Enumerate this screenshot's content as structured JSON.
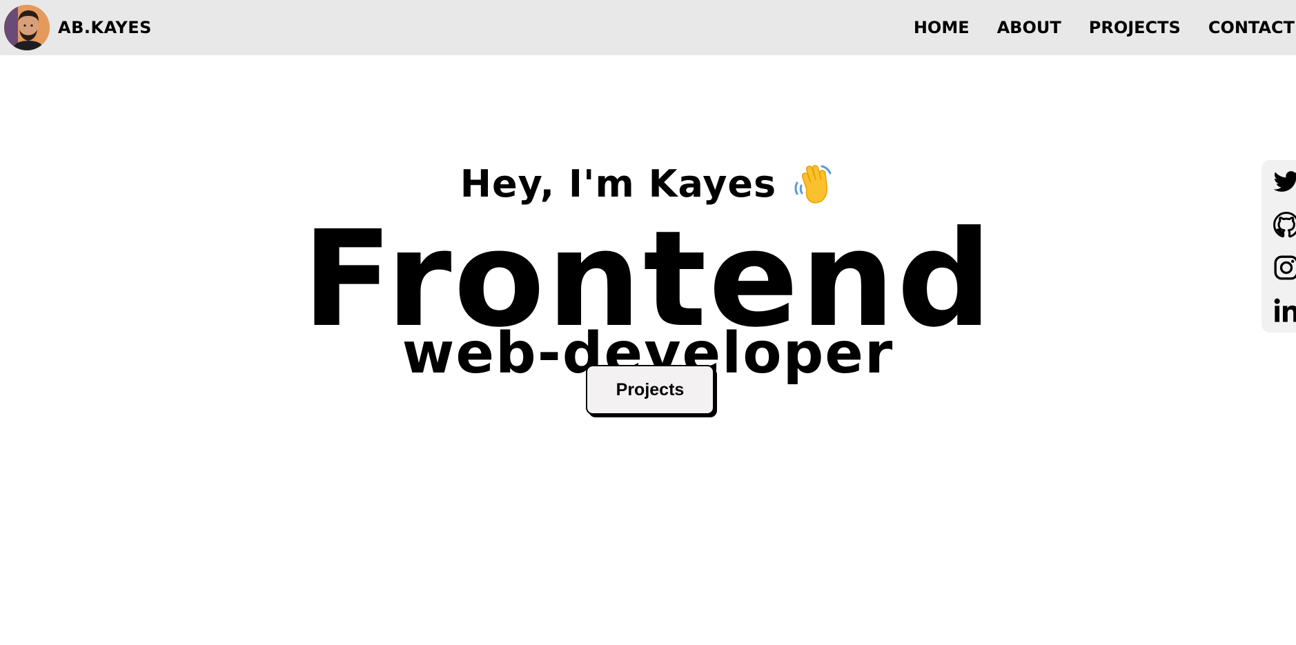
{
  "header": {
    "brand_name": "AB.KAYES",
    "nav": [
      {
        "label": "HOME"
      },
      {
        "label": "ABOUT"
      },
      {
        "label": "PROJECTS"
      },
      {
        "label": "CONTACT"
      }
    ]
  },
  "hero": {
    "greeting": "Hey, I'm Kayes",
    "greeting_icon": "waving-hand-icon",
    "title": "Frontend",
    "subtitle": "web-developer",
    "cta_label": "Projects"
  },
  "social": {
    "icons": [
      "twitter-icon",
      "github-icon",
      "instagram-icon",
      "linkedin-icon"
    ]
  },
  "colors": {
    "navbar_bg": "#e8e8e8",
    "page_bg": "#ffffff",
    "text": "#000000",
    "button_bg": "#f3f1f1",
    "social_bar_bg": "#f1f1f1"
  }
}
